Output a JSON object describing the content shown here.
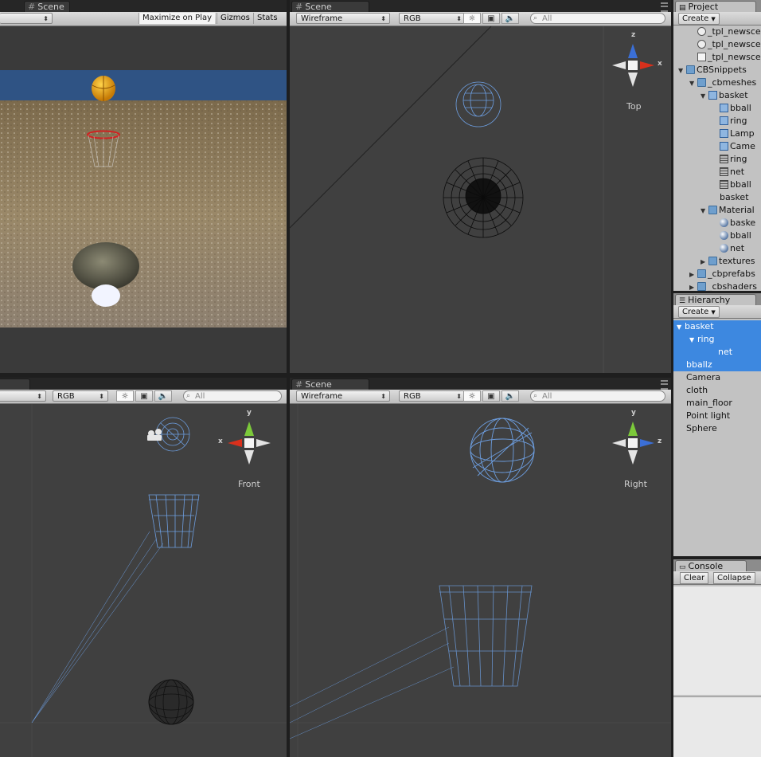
{
  "game_view": {
    "tab": "Scene",
    "maximize_label": "Maximize on Play",
    "gizmos_label": "Gizmos",
    "stats_label": "Stats",
    "aspect_arrow": "⬍"
  },
  "top_view": {
    "tab": "Scene",
    "render_mode": "Wireframe",
    "channel": "RGB",
    "search_placeholder": "All",
    "view_label": "Top",
    "axis_x": "x",
    "axis_z": "z"
  },
  "front_view": {
    "channel": "RGB",
    "search_placeholder": "All",
    "view_label": "Front",
    "axis_y": "y",
    "axis_x": "x"
  },
  "right_view": {
    "tab": "Scene",
    "render_mode": "Wireframe",
    "channel": "RGB",
    "search_placeholder": "All",
    "view_label": "Right",
    "axis_y": "y",
    "axis_z": "z"
  },
  "project": {
    "tab": "Project",
    "create_label": "Create",
    "items": [
      {
        "label": "_tpl_newscen",
        "icon": "scene",
        "indent": 1,
        "arrow": ""
      },
      {
        "label": "_tpl_newscen",
        "icon": "scene",
        "indent": 1,
        "arrow": ""
      },
      {
        "label": "_tpl_newscen",
        "icon": "doc",
        "indent": 1,
        "arrow": ""
      },
      {
        "label": "CBSnippets",
        "icon": "folder",
        "indent": 0,
        "arrow": "▼"
      },
      {
        "label": "_cbmeshes",
        "icon": "folder",
        "indent": 1,
        "arrow": "▼"
      },
      {
        "label": "basket",
        "icon": "cube",
        "indent": 2,
        "arrow": "▼"
      },
      {
        "label": "bball",
        "icon": "cube",
        "indent": 3,
        "arrow": ""
      },
      {
        "label": "ring",
        "icon": "cube",
        "indent": 3,
        "arrow": ""
      },
      {
        "label": "Lamp",
        "icon": "cube",
        "indent": 3,
        "arrow": ""
      },
      {
        "label": "Came",
        "icon": "cube",
        "indent": 3,
        "arrow": ""
      },
      {
        "label": "ring",
        "icon": "grid",
        "indent": 3,
        "arrow": ""
      },
      {
        "label": "net",
        "icon": "grid",
        "indent": 3,
        "arrow": ""
      },
      {
        "label": "bball",
        "icon": "grid",
        "indent": 3,
        "arrow": ""
      },
      {
        "label": "basket",
        "icon": "",
        "indent": 3,
        "arrow": ""
      },
      {
        "label": "Material",
        "icon": "folder",
        "indent": 2,
        "arrow": "▼"
      },
      {
        "label": "baske",
        "icon": "sphere",
        "indent": 3,
        "arrow": ""
      },
      {
        "label": "bball",
        "icon": "sphere",
        "indent": 3,
        "arrow": ""
      },
      {
        "label": "net",
        "icon": "sphere",
        "indent": 3,
        "arrow": ""
      },
      {
        "label": "textures",
        "icon": "folder",
        "indent": 2,
        "arrow": "▶"
      },
      {
        "label": "_cbprefabs",
        "icon": "folder",
        "indent": 1,
        "arrow": "▶"
      },
      {
        "label": "_cbshaders",
        "icon": "folder",
        "indent": 1,
        "arrow": "▶"
      }
    ]
  },
  "hierarchy": {
    "tab": "Hierarchy",
    "create_label": "Create",
    "items": [
      {
        "label": "basket",
        "indent": 0,
        "arrow": "▼",
        "selected": true
      },
      {
        "label": "ring",
        "indent": 1,
        "arrow": "▼",
        "selected": true
      },
      {
        "label": "net",
        "indent": 2,
        "arrow": "",
        "selected": true
      },
      {
        "label": "bballz",
        "indent": 0,
        "arrow": "",
        "selected": true
      },
      {
        "label": "Camera",
        "indent": 0,
        "arrow": "",
        "selected": false
      },
      {
        "label": "cloth",
        "indent": 0,
        "arrow": "",
        "selected": false
      },
      {
        "label": "main_floor",
        "indent": 0,
        "arrow": "",
        "selected": false
      },
      {
        "label": "Point light",
        "indent": 0,
        "arrow": "",
        "selected": false
      },
      {
        "label": "Sphere",
        "indent": 0,
        "arrow": "",
        "selected": false
      }
    ]
  },
  "console": {
    "tab": "Console",
    "clear_label": "Clear",
    "collapse_label": "Collapse"
  },
  "colors": {
    "selection": "#3d88e0",
    "wire_blue": "#6d9ee0",
    "axis_red": "#d9301c",
    "axis_green": "#7cc93a",
    "axis_blue": "#3b6fd6"
  }
}
